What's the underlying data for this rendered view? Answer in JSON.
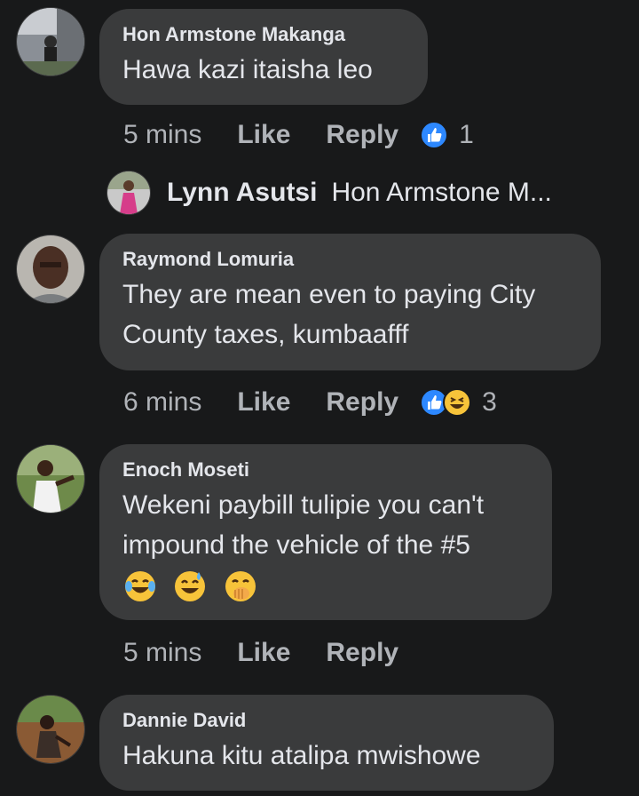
{
  "comments": [
    {
      "author": "Hon Armstone Makanga",
      "text": "Hawa kazi itaisha leo",
      "time": "5 mins",
      "like": "Like",
      "reply": "Reply",
      "reaction_count": "1",
      "reaction_icons": [
        "like-reaction-icon"
      ]
    },
    {
      "author": "Raymond Lomuria",
      "text_line1": "They are mean even to paying City",
      "text_line2": "County taxes, kumbaafff",
      "time": "6 mins",
      "like": "Like",
      "reply": "Reply",
      "reaction_count": "3",
      "reaction_icons": [
        "like-reaction-icon",
        "haha-reaction-icon"
      ]
    },
    {
      "author": "Enoch Moseti",
      "text_line1": "Wekeni paybill tulipie you can't",
      "text_line2": "impound the vehicle of the #5",
      "emoji": [
        "tears-of-joy-emoji",
        "sweat-smile-emoji",
        "hand-over-mouth-emoji"
      ],
      "time": "5 mins",
      "like": "Like",
      "reply": "Reply"
    },
    {
      "author": "Dannie David",
      "text": "Hakuna kitu atalipa mwishowe"
    }
  ],
  "reply_preview": {
    "author": "Lynn Asutsi",
    "text": "Hon Armstone M..."
  },
  "colors": {
    "background": "#18191a",
    "bubble": "#3a3b3c",
    "secondary_text": "#b0b3b8",
    "like_blue": "#2d88ff"
  }
}
